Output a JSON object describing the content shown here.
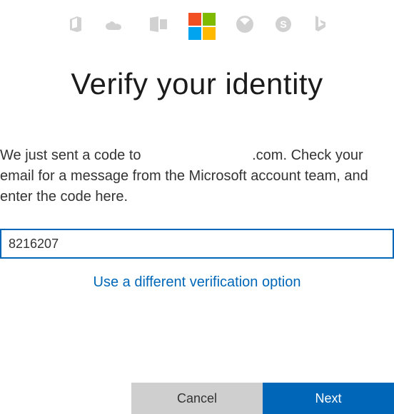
{
  "icons": {
    "office": "office-icon",
    "onedrive": "onedrive-icon",
    "outlook": "outlook-icon",
    "microsoft": "microsoft-logo",
    "xbox": "xbox-icon",
    "skype": "skype-icon",
    "bing": "bing-icon"
  },
  "title": "Verify your identity",
  "instructions_prefix": "We just sent a code to ",
  "instructions_masked_email_suffix": ".com",
  "instructions_suffix": ". Check your email for a message from the Microsoft account team, and enter the code here.",
  "code_value": "8216207",
  "alt_option_label": "Use a different verification option",
  "buttons": {
    "cancel": "Cancel",
    "next": "Next"
  }
}
